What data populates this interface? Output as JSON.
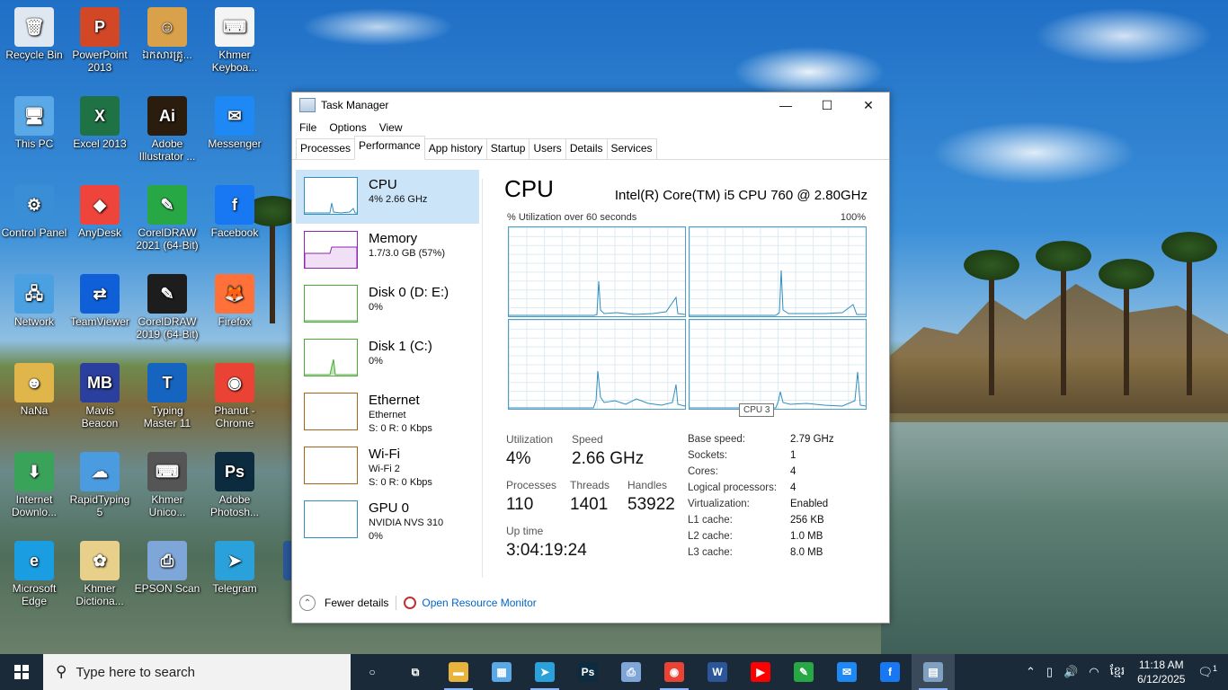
{
  "desktop_icons": [
    {
      "id": "recycle",
      "label": "Recycle Bin",
      "color": "#dfe8f0",
      "glyph": "🗑"
    },
    {
      "id": "ppt",
      "label": "PowerPoint 2013",
      "color": "#d24726",
      "glyph": "P"
    },
    {
      "id": "khmer-photo",
      "label": "ឯកសារគ្រូ...",
      "color": "#d8a14a",
      "glyph": "☺"
    },
    {
      "id": "khmer-keyboard",
      "label": "Khmer Keyboa...",
      "color": "#f4f4f4",
      "glyph": "⌨"
    },
    {
      "id": "thispc",
      "label": "This PC",
      "color": "#5aa9e6",
      "glyph": "🖥"
    },
    {
      "id": "excel",
      "label": "Excel 2013",
      "color": "#1f7244",
      "glyph": "X"
    },
    {
      "id": "illustrator",
      "label": "Adobe Illustrator ...",
      "color": "#2b1d0d",
      "glyph": "Ai"
    },
    {
      "id": "messenger",
      "label": "Messenger",
      "color": "#1e88f5",
      "glyph": "✉"
    },
    {
      "id": "control",
      "label": "Control Panel",
      "color": "#3a8ed6",
      "glyph": "⚙"
    },
    {
      "id": "anydesk",
      "label": "AnyDesk",
      "color": "#ef443b",
      "glyph": "◆"
    },
    {
      "id": "coreldraw21",
      "label": "CorelDRAW 2021 (64-Bit)",
      "color": "#27a844",
      "glyph": "✎"
    },
    {
      "id": "facebook",
      "label": "Facebook",
      "color": "#1877f2",
      "glyph": "f"
    },
    {
      "id": "network",
      "label": "Network",
      "color": "#4aa0e0",
      "glyph": "🖧"
    },
    {
      "id": "teamviewer",
      "label": "TeamViewer",
      "color": "#0e5fd8",
      "glyph": "⇄"
    },
    {
      "id": "coreldraw19",
      "label": "CorelDRAW 2019 (64-Bit)",
      "color": "#1d1d1d",
      "glyph": "✎"
    },
    {
      "id": "firefox",
      "label": "Firefox",
      "color": "#ff7139",
      "glyph": "🦊"
    },
    {
      "id": "nana",
      "label": "NaNa",
      "color": "#e0b64a",
      "glyph": "☻"
    },
    {
      "id": "mavis",
      "label": "Mavis Beacon",
      "color": "#2b3f9e",
      "glyph": "MB"
    },
    {
      "id": "typingmaster",
      "label": "Typing Master 11",
      "color": "#1565c0",
      "glyph": "T"
    },
    {
      "id": "chrome-phanut",
      "label": "Phanut - Chrome",
      "color": "#ea4335",
      "glyph": "◉"
    },
    {
      "id": "idm",
      "label": "Internet Downlo...",
      "color": "#3aa35a",
      "glyph": "⬇"
    },
    {
      "id": "rapidtyping",
      "label": "RapidTyping 5",
      "color": "#4b9be0",
      "glyph": "☁"
    },
    {
      "id": "khmer-unicode",
      "label": "Khmer Unico...",
      "color": "#555",
      "glyph": "⌨"
    },
    {
      "id": "photoshop",
      "label": "Adobe Photosh...",
      "color": "#0d2b3e",
      "glyph": "Ps"
    },
    {
      "id": "edge",
      "label": "Microsoft Edge",
      "color": "#1b9de2",
      "glyph": "e"
    },
    {
      "id": "khmer-dict",
      "label": "Khmer Dictiona...",
      "color": "#e9d08a",
      "glyph": "✿"
    },
    {
      "id": "epson",
      "label": "EPSON Scan",
      "color": "#7fa6d8",
      "glyph": "⎙"
    },
    {
      "id": "telegram",
      "label": "Telegram",
      "color": "#2aa1da",
      "glyph": "➤"
    },
    {
      "id": "word-partial",
      "label": "Wo",
      "color": "#2b579a",
      "glyph": "W"
    }
  ],
  "window": {
    "title": "Task Manager",
    "minimize": "—",
    "maximize": "☐",
    "close": "✕",
    "menu": [
      "File",
      "Options",
      "View"
    ],
    "tabs": [
      "Processes",
      "Performance",
      "App history",
      "Startup",
      "Users",
      "Details",
      "Services"
    ],
    "active_tab": "Performance"
  },
  "sidebar": [
    {
      "name": "CPU",
      "line1": "4% 2.66 GHz",
      "line2": "",
      "color": "#2f8fbf",
      "selected": true
    },
    {
      "name": "Memory",
      "line1": "1.7/3.0 GB (57%)",
      "line2": "",
      "color": "#8b26b0",
      "selected": false
    },
    {
      "name": "Disk 0 (D: E:)",
      "line1": "0%",
      "line2": "",
      "color": "#4aa836",
      "selected": false
    },
    {
      "name": "Disk 1 (C:)",
      "line1": "0%",
      "line2": "",
      "color": "#4aa836",
      "selected": false
    },
    {
      "name": "Ethernet",
      "line1": "Ethernet",
      "line2": "S: 0 R: 0 Kbps",
      "color": "#a6631b",
      "selected": false
    },
    {
      "name": "Wi-Fi",
      "line1": "Wi-Fi 2",
      "line2": "S: 0 R: 0 Kbps",
      "color": "#a6631b",
      "selected": false
    },
    {
      "name": "GPU 0",
      "line1": "NVIDIA NVS 310",
      "line2": "0%",
      "color": "#2f8fbf",
      "selected": false
    }
  ],
  "cpu": {
    "title": "CPU",
    "model": "Intel(R) Core(TM) i5 CPU 760 @ 2.80GHz",
    "util_label": "% Utilization over 60 seconds",
    "util_max": "100%",
    "tooltip": "CPU 3",
    "stats": {
      "utilization_label": "Utilization",
      "utilization": "4%",
      "speed_label": "Speed",
      "speed": "2.66 GHz",
      "processes_label": "Processes",
      "processes": "110",
      "threads_label": "Threads",
      "threads": "1401",
      "handles_label": "Handles",
      "handles": "53922",
      "uptime_label": "Up time",
      "uptime": "3:04:19:24"
    },
    "specs": [
      {
        "k": "Base speed:",
        "v": "2.79 GHz"
      },
      {
        "k": "Sockets:",
        "v": "1"
      },
      {
        "k": "Cores:",
        "v": "4"
      },
      {
        "k": "Logical processors:",
        "v": "4"
      },
      {
        "k": "Virtualization:",
        "v": "Enabled"
      },
      {
        "k": "L1 cache:",
        "v": "256 KB"
      },
      {
        "k": "L2 cache:",
        "v": "1.0 MB"
      },
      {
        "k": "L3 cache:",
        "v": "8.0 MB"
      }
    ],
    "line_color": "#2f8fbf"
  },
  "footer": {
    "fewer": "Fewer details",
    "resmon": "Open Resource Monitor"
  },
  "taskbar": {
    "search_placeholder": "Type here to search",
    "apps": [
      {
        "id": "cortana",
        "glyph": "○",
        "color": "transparent"
      },
      {
        "id": "taskview",
        "glyph": "⧉",
        "color": "transparent"
      },
      {
        "id": "explorer",
        "glyph": "▬",
        "color": "#e8b43c"
      },
      {
        "id": "control",
        "glyph": "▦",
        "color": "#5aa9e6"
      },
      {
        "id": "telegram",
        "glyph": "➤",
        "color": "#2aa1da"
      },
      {
        "id": "photoshop",
        "glyph": "Ps",
        "color": "#0d2b3e"
      },
      {
        "id": "epson",
        "glyph": "⎙",
        "color": "#7fa6d8"
      },
      {
        "id": "chrome",
        "glyph": "◉",
        "color": "#ea4335"
      },
      {
        "id": "word",
        "glyph": "W",
        "color": "#2b579a"
      },
      {
        "id": "youtube",
        "glyph": "▶",
        "color": "#ff0000"
      },
      {
        "id": "corel",
        "glyph": "✎",
        "color": "#27a844"
      },
      {
        "id": "messenger",
        "glyph": "✉",
        "color": "#1e88f5"
      },
      {
        "id": "facebook",
        "glyph": "f",
        "color": "#1877f2"
      },
      {
        "id": "taskmgr",
        "glyph": "▤",
        "color": "#7fa0c0"
      }
    ],
    "time": "11:18 AM",
    "date": "6/12/2025",
    "notif_count": "1"
  }
}
